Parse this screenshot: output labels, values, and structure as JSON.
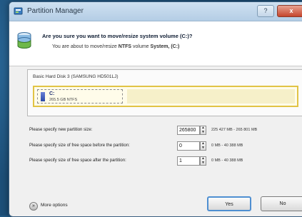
{
  "window": {
    "title": "Partition Manager",
    "close_label": "x",
    "min_label": "?"
  },
  "header": {
    "question": "Are you sure you want to move/resize system volume (C:)?",
    "info_prefix": "You are about to move/resize",
    "info_fs": "NTFS",
    "info_mid": "volume",
    "info_volume": "System, (C:)"
  },
  "disk": {
    "label": "Basic Hard Disk 3 (SAMSUNG HD501LJ)",
    "partition_name": "C:",
    "partition_size": "265.5 GB NTFS"
  },
  "form": {
    "new_size_label": "Please specify new partition size:",
    "new_size_value": "265800",
    "new_size_range": "225 427 MB - 265 801 MB",
    "before_label": "Please specify size of free space before the partition:",
    "before_value": "0",
    "before_range": "0 MB - 40 388 MB",
    "after_label": "Please specify size of free space after the partition:",
    "after_value": "1",
    "after_range": "0 MB - 40 388 MB"
  },
  "footer": {
    "more_options": "More options",
    "yes": "Yes",
    "no": "No"
  },
  "colors": {
    "partition_border": "#e1c445",
    "partition_fill": "#fffcea",
    "accent_blue": "#2b4aa8"
  },
  "icons": [
    "partition-manager-icon",
    "disk-icon",
    "more-options-icon",
    "spin-up-icon",
    "spin-down-icon"
  ]
}
